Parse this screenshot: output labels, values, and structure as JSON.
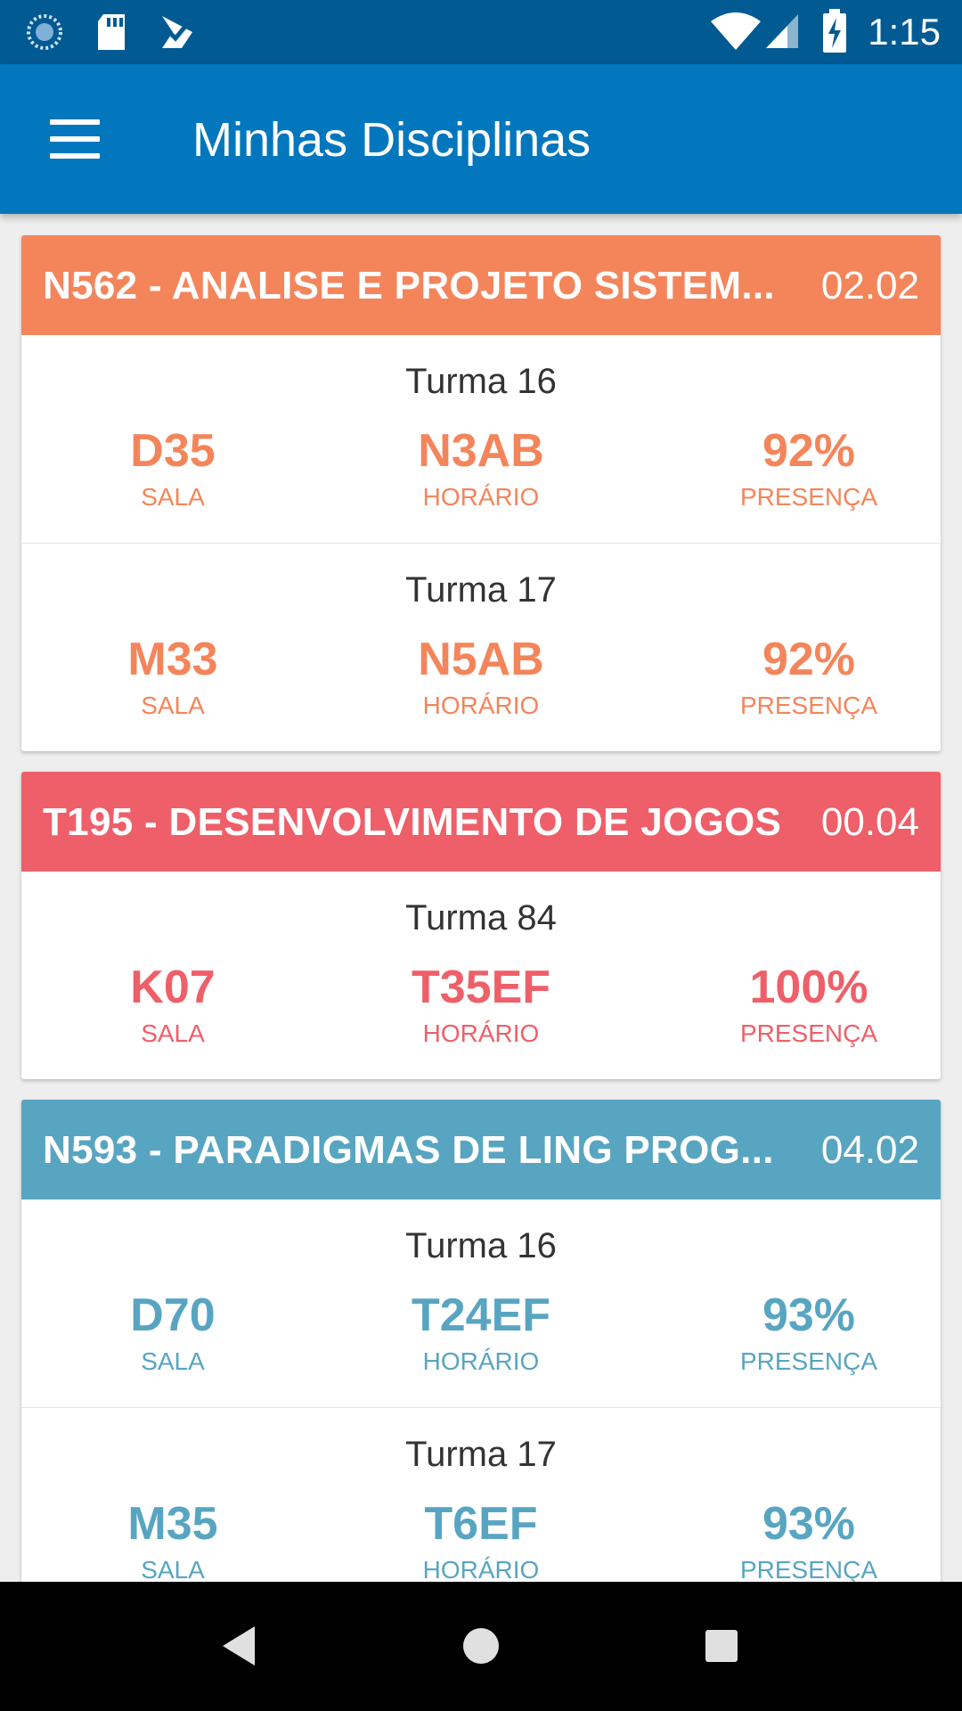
{
  "status_bar": {
    "time": "1:15",
    "left_icons": [
      "sync-icon",
      "sd-card-icon",
      "task-check-icon"
    ],
    "right_icons": [
      "wifi-icon",
      "cell-signal-icon",
      "battery-charging-icon"
    ]
  },
  "app_bar": {
    "title": "Minhas Disciplinas",
    "menu_icon": "menu-icon",
    "color": "#0277bd"
  },
  "courses": [
    {
      "title": "N562 - ANALISE E PROJETO SISTEM...",
      "code": "02.02",
      "color": "#f4855b",
      "turmas": [
        {
          "label": "Turma 16",
          "sala": "D35",
          "horario": "N3AB",
          "presenca": "92%",
          "sala_label": "SALA",
          "horario_label": "HORÁRIO",
          "presenca_label": "PRESENÇA"
        },
        {
          "label": "Turma 17",
          "sala": "M33",
          "horario": "N5AB",
          "presenca": "92%",
          "sala_label": "SALA",
          "horario_label": "HORÁRIO",
          "presenca_label": "PRESENÇA"
        }
      ]
    },
    {
      "title": "T195 - DESENVOLVIMENTO DE JOGOS",
      "code": "00.04",
      "color": "#ef5f69",
      "turmas": [
        {
          "label": "Turma 84",
          "sala": "K07",
          "horario": "T35EF",
          "presenca": "100%",
          "sala_label": "SALA",
          "horario_label": "HORÁRIO",
          "presenca_label": "PRESENÇA"
        }
      ]
    },
    {
      "title": "N593 - PARADIGMAS DE LING PROG...",
      "code": "04.02",
      "color": "#58a5c1",
      "turmas": [
        {
          "label": "Turma 16",
          "sala": "D70",
          "horario": "T24EF",
          "presenca": "93%",
          "sala_label": "SALA",
          "horario_label": "HORÁRIO",
          "presenca_label": "PRESENÇA"
        },
        {
          "label": "Turma 17",
          "sala": "M35",
          "horario": "T6EF",
          "presenca": "93%",
          "sala_label": "SALA",
          "horario_label": "HORÁRIO",
          "presenca_label": "PRESENÇA"
        }
      ]
    }
  ],
  "nav_bar": {
    "buttons": [
      "back-icon",
      "home-icon",
      "recents-icon"
    ]
  }
}
